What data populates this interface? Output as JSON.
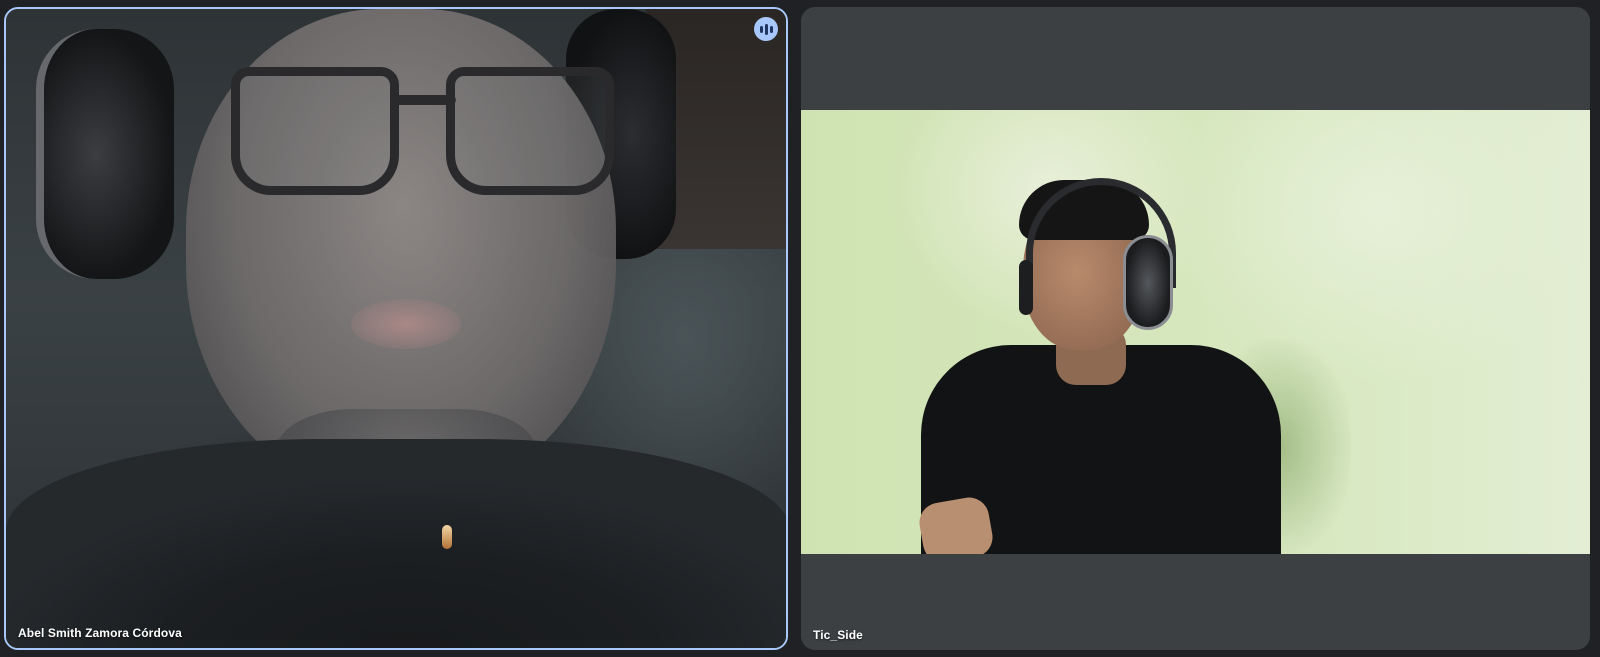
{
  "participants": [
    {
      "name": "Abel Smith Zamora Córdova",
      "speaking": true,
      "icon": "audio-level-icon"
    },
    {
      "name": "Tic_Side",
      "speaking": false
    }
  ],
  "colors": {
    "background": "#202124",
    "tile": "#3c4043",
    "speaking_accent": "#a8c7fa"
  }
}
